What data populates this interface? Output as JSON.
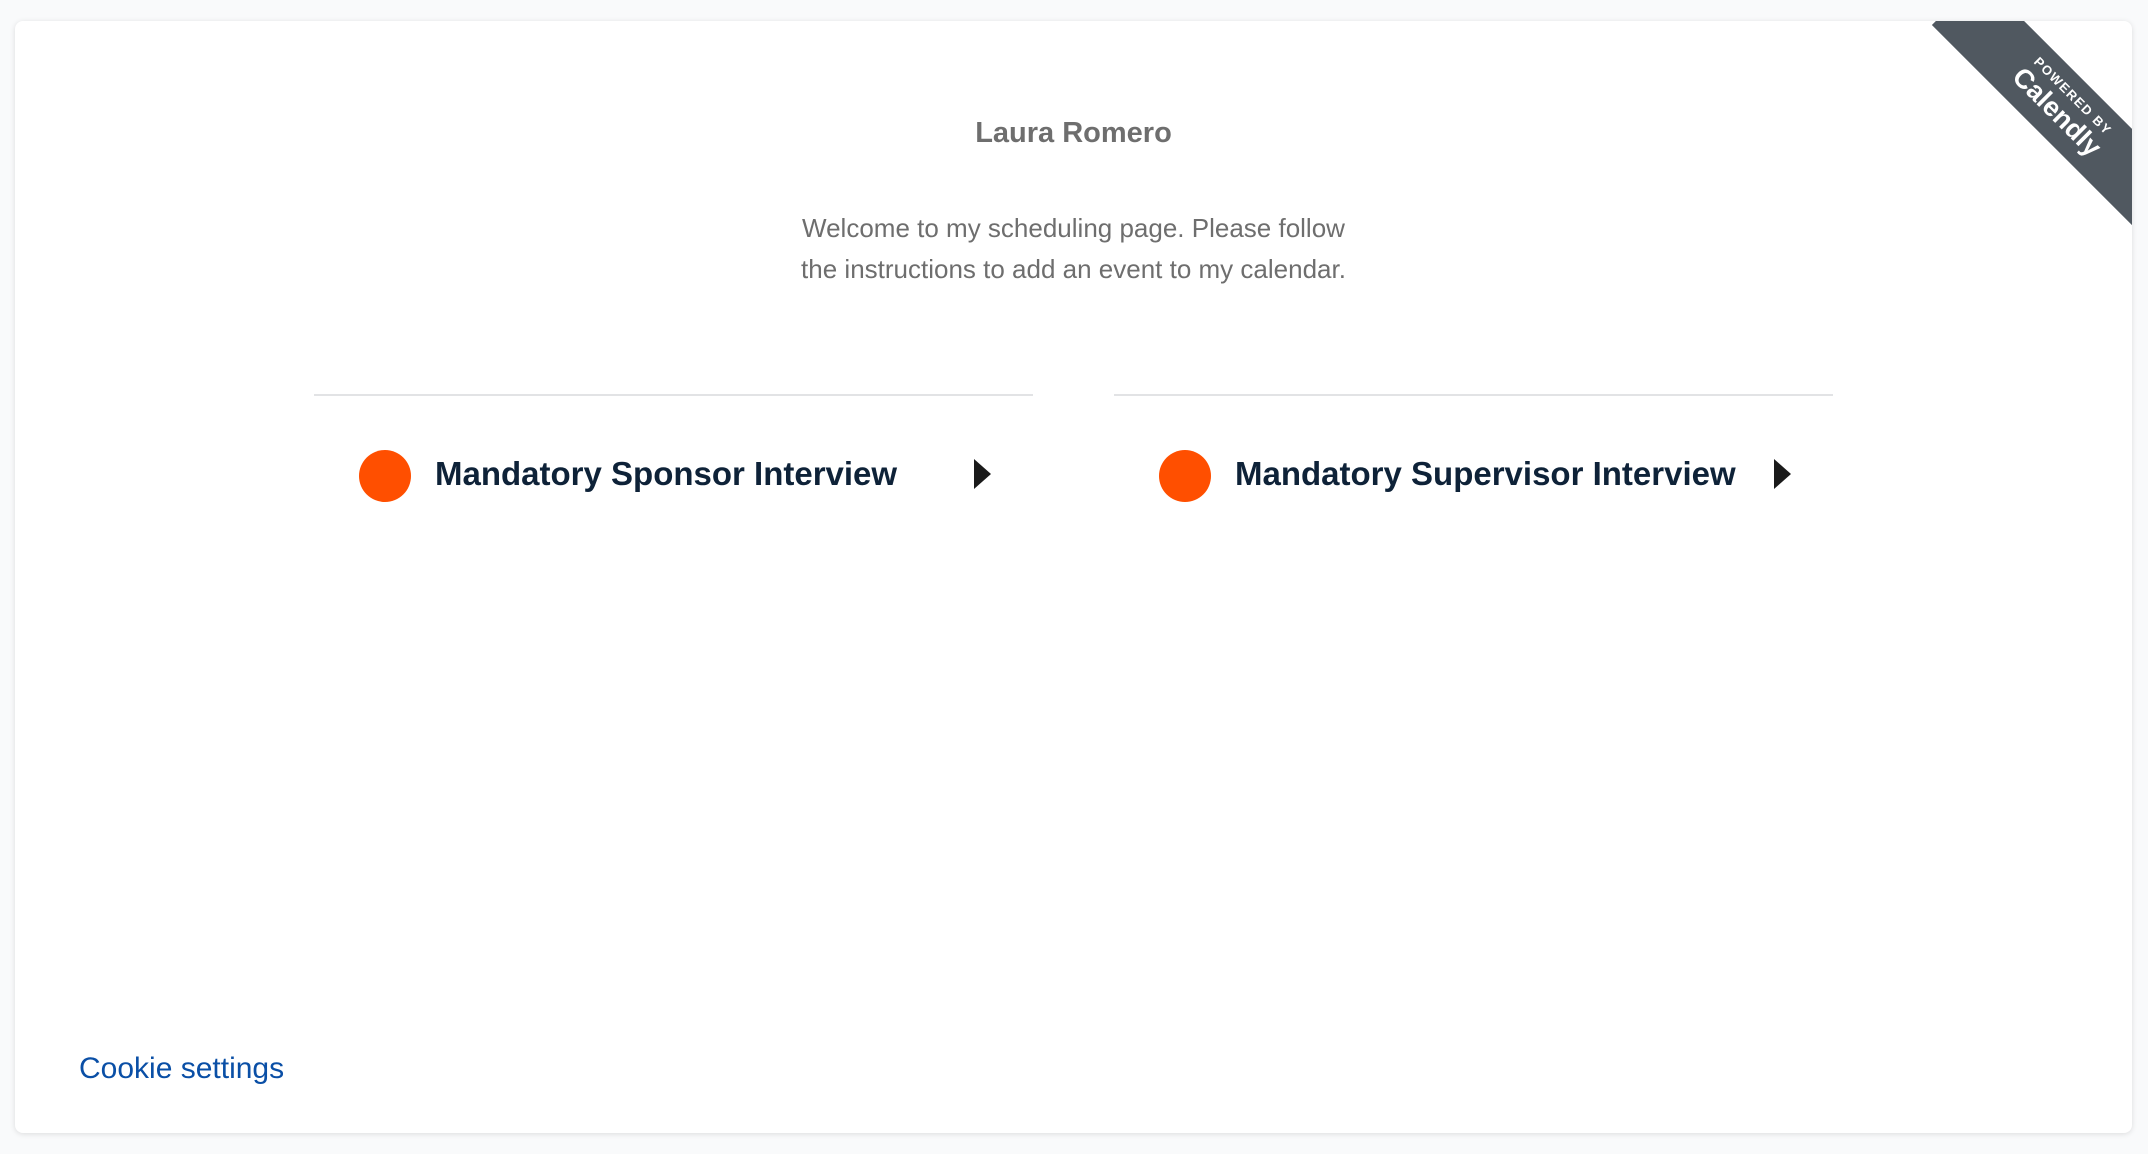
{
  "ribbon": {
    "powered_label": "POWERED BY",
    "brand_label": "Calendly",
    "color": "#505860"
  },
  "profile": {
    "name": "Laura Romero",
    "welcome": "Welcome to my scheduling page. Please follow the instructions to add an event to my calendar."
  },
  "events": [
    {
      "title": "Mandatory Sponsor Interview",
      "color": "#ff4f00"
    },
    {
      "title": "Mandatory Supervisor Interview",
      "color": "#ff4f00"
    }
  ],
  "footer": {
    "cookie_label": "Cookie settings"
  }
}
